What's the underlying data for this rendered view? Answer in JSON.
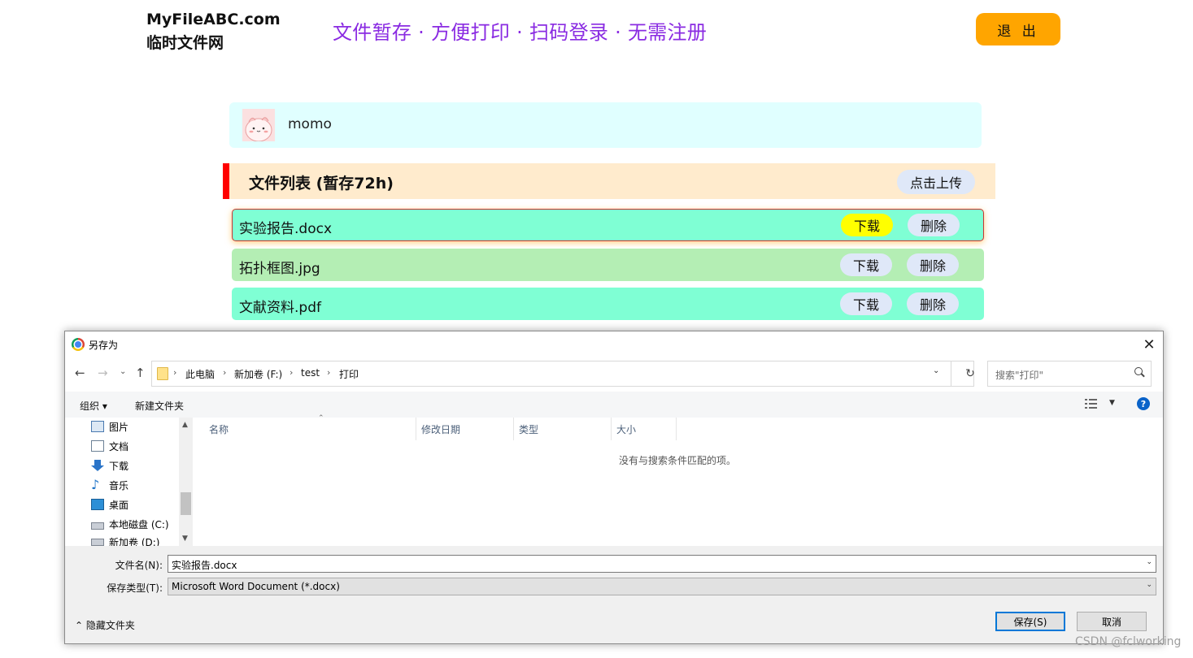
{
  "site": {
    "logo_line1": "MyFileABC.com",
    "logo_line2": "临时文件网",
    "slogan": "文件暂存 · 方便打印 · 扫码登录 · 无需注册",
    "logout_label": "退 出"
  },
  "user": {
    "name": "momo"
  },
  "file_list": {
    "title": "文件列表 (暂存72h)",
    "upload_label": "点击上传",
    "files": [
      {
        "name": "实验报告.docx",
        "download_label": "下载",
        "delete_label": "删除"
      },
      {
        "name": "拓扑框图.jpg",
        "download_label": "下载",
        "delete_label": "删除"
      },
      {
        "name": "文献资料.pdf",
        "download_label": "下载",
        "delete_label": "删除"
      }
    ]
  },
  "dialog": {
    "title": "另存为",
    "close": "✕",
    "breadcrumb": [
      "此电脑",
      "新加卷 (F:)",
      "test",
      "打印"
    ],
    "search_placeholder": "搜索\"打印\"",
    "toolbar": {
      "organize": "组织 ▾",
      "new_folder": "新建文件夹",
      "help": "?"
    },
    "nav_items": [
      "图片",
      "文档",
      "下载",
      "音乐",
      "桌面",
      "本地磁盘 (C:)",
      "新加卷 (D:)"
    ],
    "columns": [
      "名称",
      "修改日期",
      "类型",
      "大小"
    ],
    "empty_message": "没有与搜索条件匹配的项。",
    "filename_label": "文件名(N):",
    "filename_value": "实验报告.docx",
    "filetype_label": "保存类型(T):",
    "filetype_value": "Microsoft Word Document (*.docx)",
    "hide_folders": "隐藏文件夹",
    "save_label": "保存(S)",
    "cancel_label": "取消"
  },
  "watermark": "CSDN @fclworking",
  "colors": {
    "slogan": "#8a2be2",
    "logout_bg": "#ffa500",
    "user_card_bg": "#e0ffff",
    "list_header_bg": "#ffebcd",
    "accent_bar": "#ff0000",
    "row_aqua": "#7fffd4",
    "row_green": "#b4eeb4",
    "download_active": "#ffff00"
  }
}
